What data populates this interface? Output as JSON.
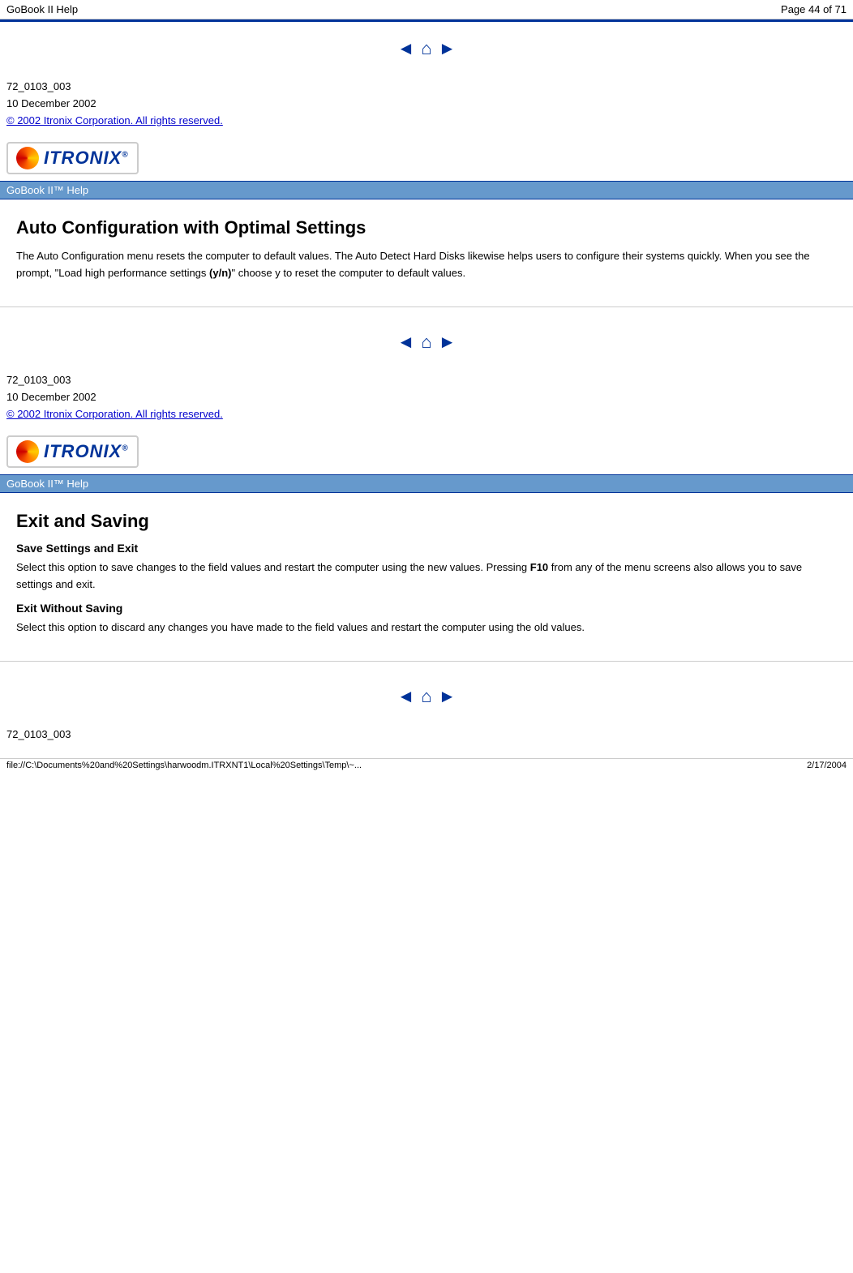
{
  "topbar": {
    "title": "GoBook II Help",
    "page_label": "Page 44 of 71"
  },
  "sections": [
    {
      "id": "auto-config",
      "nav": {
        "prev_arrow": "◄",
        "home_icon": "⌂",
        "next_arrow": "►"
      },
      "footer": {
        "doc_id": "72_0103_003",
        "date": "10 December 2002",
        "copyright_link": "© 2002 Itronix Corporation.  All rights reserved."
      },
      "logo_text": "ITRONIX",
      "logo_reg": "®",
      "header_bar_label": "GoBook II™ Help",
      "section_title": "Auto Configuration with Optimal Settings",
      "body": "The Auto Configuration menu resets the computer to default values.  The Auto Detect Hard Disks likewise helps users to configure their systems quickly.  When you see the prompt, \"Load high performance settings (y/n)\" choose y to reset the computer to default values."
    },
    {
      "id": "exit-saving",
      "nav": {
        "prev_arrow": "◄",
        "home_icon": "⌂",
        "next_arrow": "►"
      },
      "footer": {
        "doc_id": "72_0103_003",
        "date": "10 December 2002",
        "copyright_link": "© 2002 Itronix Corporation.  All rights reserved."
      },
      "logo_text": "ITRONIX",
      "logo_reg": "®",
      "header_bar_label": "GoBook II™ Help",
      "section_title": "Exit and Saving",
      "subsections": [
        {
          "title": "Save Settings and Exit",
          "body": "Select this option to save changes to the field values and restart the computer using the new values.  Pressing F10 from any of the menu screens also allows you to save settings and exit.",
          "bold_part": "F10"
        },
        {
          "title": "Exit Without Saving",
          "body": "Select this option to discard any changes you have made to the field values and restart the computer using the old values."
        }
      ]
    },
    {
      "id": "bottom-nav",
      "nav": {
        "prev_arrow": "◄",
        "home_icon": "⌂",
        "next_arrow": "►"
      },
      "footer": {
        "doc_id": "72_0103_003"
      }
    }
  ],
  "statusbar": {
    "path": "file://C:\\Documents%20and%20Settings\\harwoodm.ITRXNT1\\Local%20Settings\\Temp\\~...",
    "date": "2/17/2004"
  }
}
